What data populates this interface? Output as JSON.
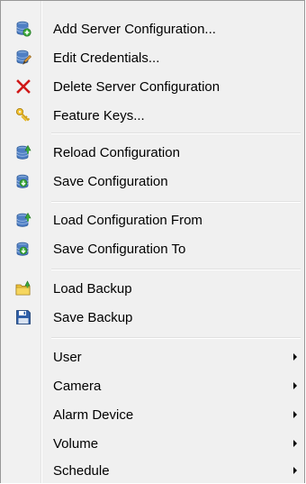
{
  "menu": {
    "items": [
      {
        "label": "Add Server Configuration...",
        "icon": "server-add-icon"
      },
      {
        "label": "Edit Credentials...",
        "icon": "server-edit-icon"
      },
      {
        "label": "Delete Server Configuration",
        "icon": "delete-x-icon"
      },
      {
        "label": "Feature Keys...",
        "icon": "keys-icon"
      },
      {
        "label": "Reload Configuration",
        "icon": "reload-config-icon"
      },
      {
        "label": "Save Configuration",
        "icon": "save-config-icon"
      },
      {
        "label": "Load Configuration From",
        "icon": "load-config-from-icon"
      },
      {
        "label": "Save Configuration To",
        "icon": "save-config-to-icon"
      },
      {
        "label": "Load Backup",
        "icon": "load-backup-icon"
      },
      {
        "label": "Save Backup",
        "icon": "save-backup-icon"
      },
      {
        "label": "User",
        "submenu": true
      },
      {
        "label": "Camera",
        "submenu": true
      },
      {
        "label": "Alarm Device",
        "submenu": true
      },
      {
        "label": "Volume",
        "submenu": true
      },
      {
        "label": "Schedule",
        "submenu": true
      }
    ]
  },
  "colors": {
    "menu_background": "#f0f0f0",
    "border": "#979797",
    "delete_red": "#d01818",
    "db_blue": "#3b6fb6",
    "green": "#39a53a",
    "key_yellow": "#e8b820"
  }
}
